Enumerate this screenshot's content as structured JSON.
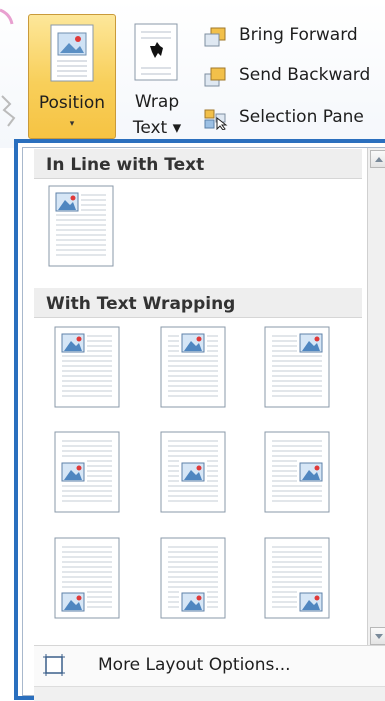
{
  "ribbon": {
    "position_label": "Position",
    "position_arrow": "▾",
    "wrap_label_line1": "Wrap",
    "wrap_label_line2": "Text ▾",
    "bring_forward": "Bring Forward",
    "send_backward": "Send Backward",
    "selection_pane": "Selection Pane"
  },
  "dropdown": {
    "section_inline": "In Line with Text",
    "section_wrapping": "With Text Wrapping",
    "more_options": "More Layout Options...",
    "wrap_positions": [
      [
        "top-left",
        "top-center",
        "top-right"
      ],
      [
        "middle-left",
        "middle-center",
        "middle-right"
      ],
      [
        "bottom-left",
        "bottom-center",
        "bottom-right"
      ]
    ]
  },
  "colors": {
    "accent_border": "#2a6fbe",
    "highlight": "#f8cf5a"
  }
}
